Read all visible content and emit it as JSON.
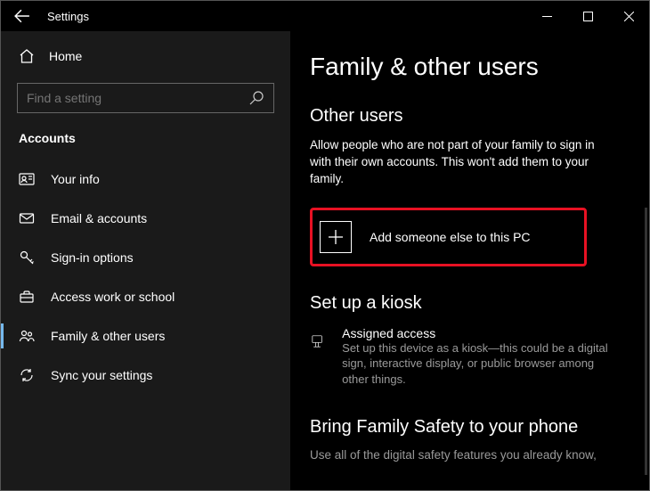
{
  "window": {
    "title": "Settings"
  },
  "sidebar": {
    "home_label": "Home",
    "search_placeholder": "Find a setting",
    "category": "Accounts",
    "items": [
      {
        "label": "Your info"
      },
      {
        "label": "Email & accounts"
      },
      {
        "label": "Sign-in options"
      },
      {
        "label": "Access work or school"
      },
      {
        "label": "Family & other users"
      },
      {
        "label": "Sync your settings"
      }
    ]
  },
  "main": {
    "page_title": "Family & other users",
    "other_users_heading": "Other users",
    "other_users_desc": "Allow people who are not part of your family to sign in with their own accounts. This won't add them to your family.",
    "add_someone_label": "Add someone else to this PC",
    "kiosk_heading": "Set up a kiosk",
    "assigned_access_title": "Assigned access",
    "assigned_access_desc": "Set up this device as a kiosk—this could be a digital sign, interactive display, or public browser among other things.",
    "family_safety_heading": "Bring Family Safety to your phone",
    "family_safety_desc": "Use all of the digital safety features you already know,"
  }
}
